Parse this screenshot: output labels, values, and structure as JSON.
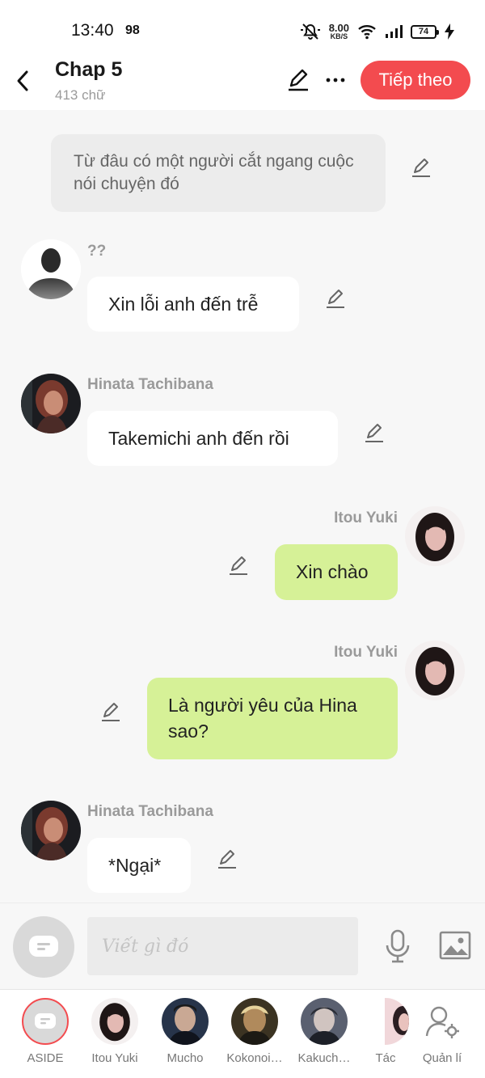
{
  "status_bar": {
    "time": "13:40",
    "extra_number": "98",
    "net_speed_value": "8.00",
    "net_speed_unit": "KB/S",
    "battery": "74"
  },
  "header": {
    "title": "Chap 5",
    "word_count": "413 chữ",
    "next_button_label": "Tiếp theo",
    "accent_color": "#f34b4f"
  },
  "chat": {
    "narration": "Từ đâu có một người cắt ngang cuộc nói chuyện đó",
    "messages": [
      {
        "sender": "??",
        "text": "Xin lỗi anh đến trễ",
        "side": "left",
        "avatar": "silhouette"
      },
      {
        "sender": "Hinata Tachibana",
        "text": "Takemichi anh đến rồi",
        "side": "left",
        "avatar": "hinata"
      },
      {
        "sender": "Itou Yuki",
        "text": "Xin chào",
        "side": "right",
        "avatar": "itou"
      },
      {
        "sender": "Itou Yuki",
        "text": "Là người yêu của Hina sao?",
        "side": "right",
        "avatar": "itou"
      },
      {
        "sender": "Hinata Tachibana",
        "text": "*Ngại*",
        "side": "left",
        "avatar": "hinata"
      }
    ],
    "colors": {
      "own_bubble": "#d6f197",
      "other_bubble": "#ffffff",
      "narration_bubble": "#ececec"
    }
  },
  "input_bar": {
    "placeholder": "Viết gì đó"
  },
  "characters": [
    {
      "label": "ASIDE",
      "avatar": "aside"
    },
    {
      "label": "Itou Yuki",
      "avatar": "itou"
    },
    {
      "label": "Mucho",
      "avatar": "mucho"
    },
    {
      "label": "Kokonoi…",
      "avatar": "kokonoi"
    },
    {
      "label": "Kakuch…",
      "avatar": "kakucho"
    },
    {
      "label": "Tác",
      "avatar": "tac"
    },
    {
      "label": "Quản lí",
      "avatar": "manage-icon"
    }
  ]
}
